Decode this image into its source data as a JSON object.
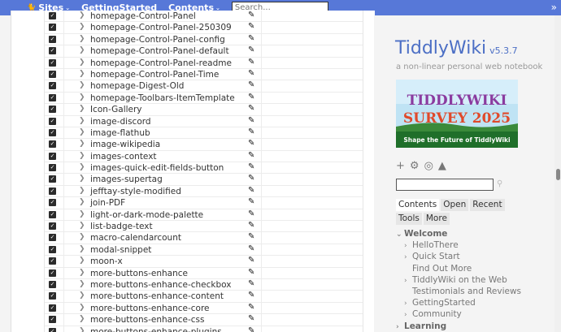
{
  "topbar": {
    "sites_label": "Sites",
    "getting_started_label": "GettingStarted",
    "contents_label": "Contents",
    "search_placeholder": "Search..."
  },
  "rows": [
    "homepage-Control-Panel",
    "homepage-Control-Panel-250309",
    "homepage-Control-Panel-config",
    "homepage-Control-Panel-default",
    "homepage-Control-Panel-readme",
    "homepage-Control-Panel-Time",
    "homepage-Digest-Old",
    "homepage-Toolbars-ItemTemplate",
    "Icon-Gallery",
    "image-discord",
    "image-flathub",
    "image-wikipedia",
    "images-context",
    "images-quick-edit-fields-button",
    "images-supertag",
    "jefftay-style-modified",
    "join-PDF",
    "light-or-dark-mode-palette",
    "list-badge-text",
    "macro-calendarcount",
    "modal-snippet",
    "moon-x",
    "more-buttons-enhance",
    "more-buttons-enhance-checkbox",
    "more-buttons-enhance-content",
    "more-buttons-enhance-core",
    "more-buttons-enhance-css",
    "more-buttons-enhance-plugins"
  ],
  "sidebar": {
    "title": "TiddlyWiki",
    "version": "v5.3.7",
    "subtitle": "a non-linear personal web notebook",
    "banner_line1": "TIDDLYWIKI",
    "banner_line2": "SURVEY 2025",
    "banner_caption": "Shape the Future of TiddlyWiki",
    "tabs": [
      "Contents",
      "Open",
      "Recent",
      "Tools",
      "More"
    ],
    "toc": [
      {
        "label": "Welcome",
        "level": 0,
        "arrow": "down"
      },
      {
        "label": "HelloThere",
        "level": 1,
        "arrow": "right"
      },
      {
        "label": "Quick Start",
        "level": 1,
        "arrow": "right"
      },
      {
        "label": "Find Out More",
        "level": 1,
        "arrow": ""
      },
      {
        "label": "TiddlyWiki on the Web",
        "level": 1,
        "arrow": "right"
      },
      {
        "label": "Testimonials and Reviews",
        "level": 1,
        "arrow": ""
      },
      {
        "label": "GettingStarted",
        "level": 1,
        "arrow": "right"
      },
      {
        "label": "Community",
        "level": 1,
        "arrow": "right"
      },
      {
        "label": "Learning",
        "level": 0,
        "arrow": "right"
      }
    ]
  },
  "colors": {
    "topbar": "#5778d8",
    "title": "#4c6fc5"
  }
}
